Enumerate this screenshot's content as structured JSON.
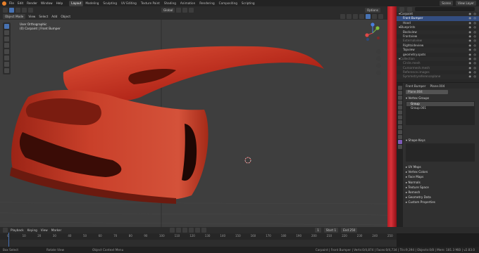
{
  "app": {
    "menus": [
      "File",
      "Edit",
      "Render",
      "Window",
      "Help"
    ],
    "workspaces": [
      "Layout",
      "Modeling",
      "Sculpting",
      "UV Editing",
      "Texture Paint",
      "Shading",
      "Animation",
      "Rendering",
      "Compositing",
      "Scripting"
    ],
    "active_workspace": "Layout",
    "scene_label": "Scene",
    "view_layer_label": "View Layer"
  },
  "viewport": {
    "orientation_label": "Global",
    "mode_label": "Object Mode",
    "header_menus": [
      "View",
      "Select",
      "Add",
      "Object"
    ],
    "options_label": "Options",
    "view_name": "User Orthographic",
    "object_info": "(0) Carpaint | Front Bumper",
    "accent_colors": {
      "selection": "#4772b3",
      "model": "#c8331c"
    }
  },
  "outliner": {
    "rows": [
      {
        "label": "Carpaint",
        "indent": 0,
        "dim": false,
        "selected": false
      },
      {
        "label": "Front Bumper",
        "indent": 1,
        "dim": false,
        "selected": true
      },
      {
        "label": "Hood",
        "indent": 1,
        "dim": false,
        "selected": false
      },
      {
        "label": "Blueprints",
        "indent": 0,
        "dim": false,
        "selected": false
      },
      {
        "label": "Backview",
        "indent": 1,
        "dim": false,
        "selected": false
      },
      {
        "label": "Frontview",
        "indent": 1,
        "dim": false,
        "selected": false
      },
      {
        "label": "Externalview",
        "indent": 1,
        "dim": true,
        "selected": false
      },
      {
        "label": "Rightsideview",
        "indent": 1,
        "dim": false,
        "selected": false
      },
      {
        "label": "Topview",
        "indent": 1,
        "dim": false,
        "selected": false
      },
      {
        "label": "geometry.spots",
        "indent": 1,
        "dim": false,
        "selected": false
      },
      {
        "label": "Collection",
        "indent": 0,
        "dim": true,
        "selected": false
      },
      {
        "label": "Circle.mesh",
        "indent": 1,
        "dim": true,
        "selected": false
      },
      {
        "label": "Cursormesh.mesh",
        "indent": 1,
        "dim": true,
        "selected": false
      },
      {
        "label": "Reference.images",
        "indent": 1,
        "dim": true,
        "selected": false
      },
      {
        "label": "Symmetryreferenceplane",
        "indent": 1,
        "dim": true,
        "selected": false
      }
    ]
  },
  "properties": {
    "breadcrumb_object": "Front Bumper",
    "breadcrumb_data": "Plane.004",
    "data_name": "Plane.004",
    "vertex_groups_title": "Vertex Groups",
    "vertex_groups": [
      "Group",
      "Group.001"
    ],
    "shape_keys_title": "Shape Keys",
    "collapsed_panels": [
      "UV Maps",
      "Vertex Colors",
      "Face Maps",
      "Normals",
      "Texture Space",
      "Remesh",
      "Geometry Data",
      "Custom Properties"
    ]
  },
  "timeline": {
    "menus": [
      "Playback",
      "Keying",
      "View",
      "Marker"
    ],
    "current_frame": "1",
    "start_label": "Start",
    "start_value": "1",
    "end_label": "End",
    "end_value": "250",
    "ticks": [
      "0",
      "10",
      "20",
      "30",
      "40",
      "50",
      "60",
      "70",
      "80",
      "90",
      "100",
      "110",
      "120",
      "130",
      "140",
      "150",
      "160",
      "170",
      "180",
      "190",
      "200",
      "210",
      "220",
      "230",
      "240",
      "250"
    ]
  },
  "status": {
    "left_items": [
      "Box Select",
      "Rotate View",
      "Object Context Menu"
    ],
    "right_text": "Carpaint | Front Bumper | Verts:0/4,874 | Faces:0/4,734 | Tris:9,394 | Objects:0/8 | Mem: 181.3 MiB | v2.83.0"
  }
}
